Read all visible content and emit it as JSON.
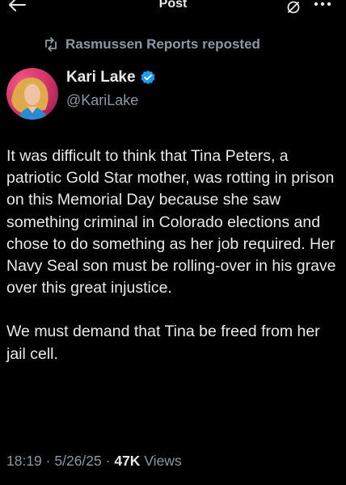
{
  "topbar": {
    "title": "Post",
    "back_icon": "arrow-left-icon",
    "grok_icon": "grok-icon",
    "more_icon": "more-horizontal-icon"
  },
  "repost": {
    "icon": "repost-icon",
    "label": "Rasmussen Reports reposted"
  },
  "author": {
    "name": "Kari Lake",
    "handle": "@KariLake",
    "verified_icon": "verified-badge-icon",
    "verified_color": "#1d9bf0"
  },
  "post": {
    "paragraphs": [
      "It was difficult to think that Tina Peters, a patriotic Gold Star mother, was rotting in prison on this Memorial Day because she saw something criminal in Colorado elections and chose to do something as her job required. Her Navy Seal son must be rolling-over in his grave over this great injustice.",
      "We must demand that Tina be freed from her jail cell."
    ]
  },
  "meta": {
    "time": "18:19",
    "separator": "·",
    "date": "5/26/25",
    "views_count": "47K",
    "views_label": "Views"
  },
  "colors": {
    "background": "#000000",
    "text_primary": "#e7e9ea",
    "text_secondary": "#8b98a5",
    "accent": "#1d9bf0"
  }
}
